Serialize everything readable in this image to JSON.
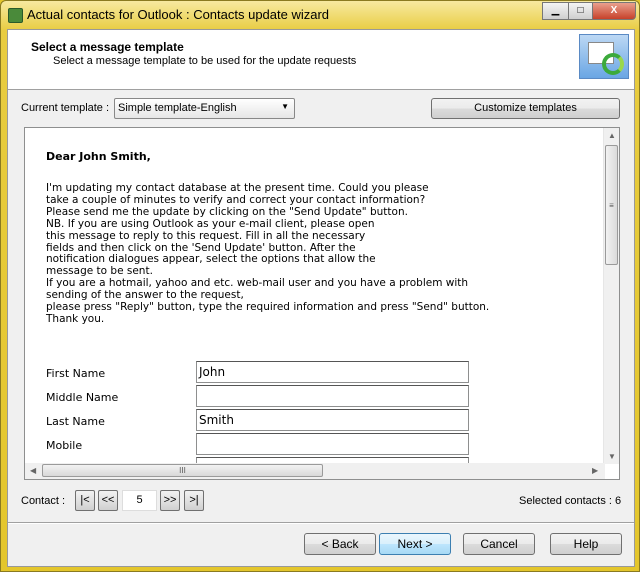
{
  "window": {
    "title": "Actual contacts for Outlook : Contacts update wizard",
    "controls": [
      "minimize",
      "maximize",
      "close"
    ],
    "border_color": "#e4c62c"
  },
  "header": {
    "title": "Select a message template",
    "subtitle": "Select a message template to be used for the update requests",
    "icon": "contact-card-sync-icon"
  },
  "template": {
    "label": "Current template :",
    "selected": "Simple template-English",
    "customize_label": "Customize templates"
  },
  "message": {
    "greeting": "Dear John Smith,",
    "body": "I'm updating my contact database at the present time. Could you please\ntake a couple of minutes to verify and correct your contact information?\nPlease send me the update by clicking on the \"Send Update\" button.\nNB. If you are using Outlook as your e-mail client, please open\nthis message to reply to this request. Fill in all the necessary\nfields and then click on the 'Send Update' button. After the\nnotification dialogues appear, select the options that allow the\nmessage to be sent.\nIf you are a hotmail, yahoo and etc. web-mail user and you have a problem with\nsending of the answer to the request,\nplease press \"Reply\" button, type the required information and press \"Send\" button.\nThank you.",
    "fields": [
      {
        "label": "First Name",
        "value": "John"
      },
      {
        "label": "Middle Name",
        "value": ""
      },
      {
        "label": "Last Name",
        "value": "Smith"
      },
      {
        "label": "Mobile",
        "value": ""
      },
      {
        "label": "",
        "value": ""
      }
    ]
  },
  "navigation": {
    "label": "Contact :",
    "first": "|<",
    "prev": "<<",
    "current": "5",
    "next": ">>",
    "last": ">|",
    "selected_label": "Selected contacts : 6"
  },
  "footer": {
    "back": "< Back",
    "next": "Next >",
    "cancel": "Cancel",
    "help": "Help"
  }
}
